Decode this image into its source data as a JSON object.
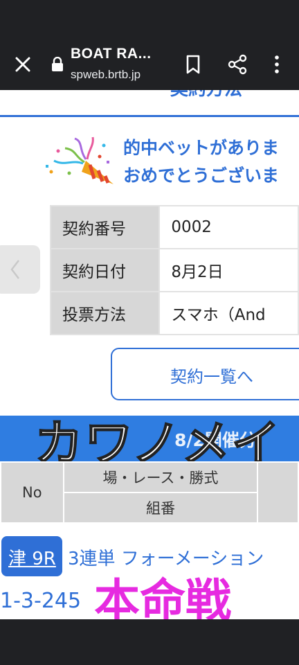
{
  "browser": {
    "title": "BOAT RA...",
    "url": "spweb.brtb.jp"
  },
  "page": {
    "section_title": "契約方法",
    "congrats_line1": "的中ベットがありま",
    "congrats_line2": "おめでとうございま",
    "info_rows": [
      {
        "key": "契約番号",
        "value": "0002"
      },
      {
        "key": "契約日付",
        "value": "8月2日"
      },
      {
        "key": "投票方法",
        "value": "スマホ（And"
      }
    ],
    "list_button_label": "契約一覧へ",
    "banner_date": "8/2開催分",
    "overlay_name": "カワノメイ",
    "table_header": {
      "no": "No",
      "row1": "場・レース・勝式",
      "row2": "組番"
    },
    "race_badge": "津 9R",
    "bet_type": "3連単 フォーメーション",
    "combo": "1-3-245",
    "honmei": "本命戦"
  },
  "colors": {
    "accent": "#2f6fd6",
    "banner": "#2f7de1",
    "highlight": "#e62ae0",
    "chrome": "#202124"
  }
}
